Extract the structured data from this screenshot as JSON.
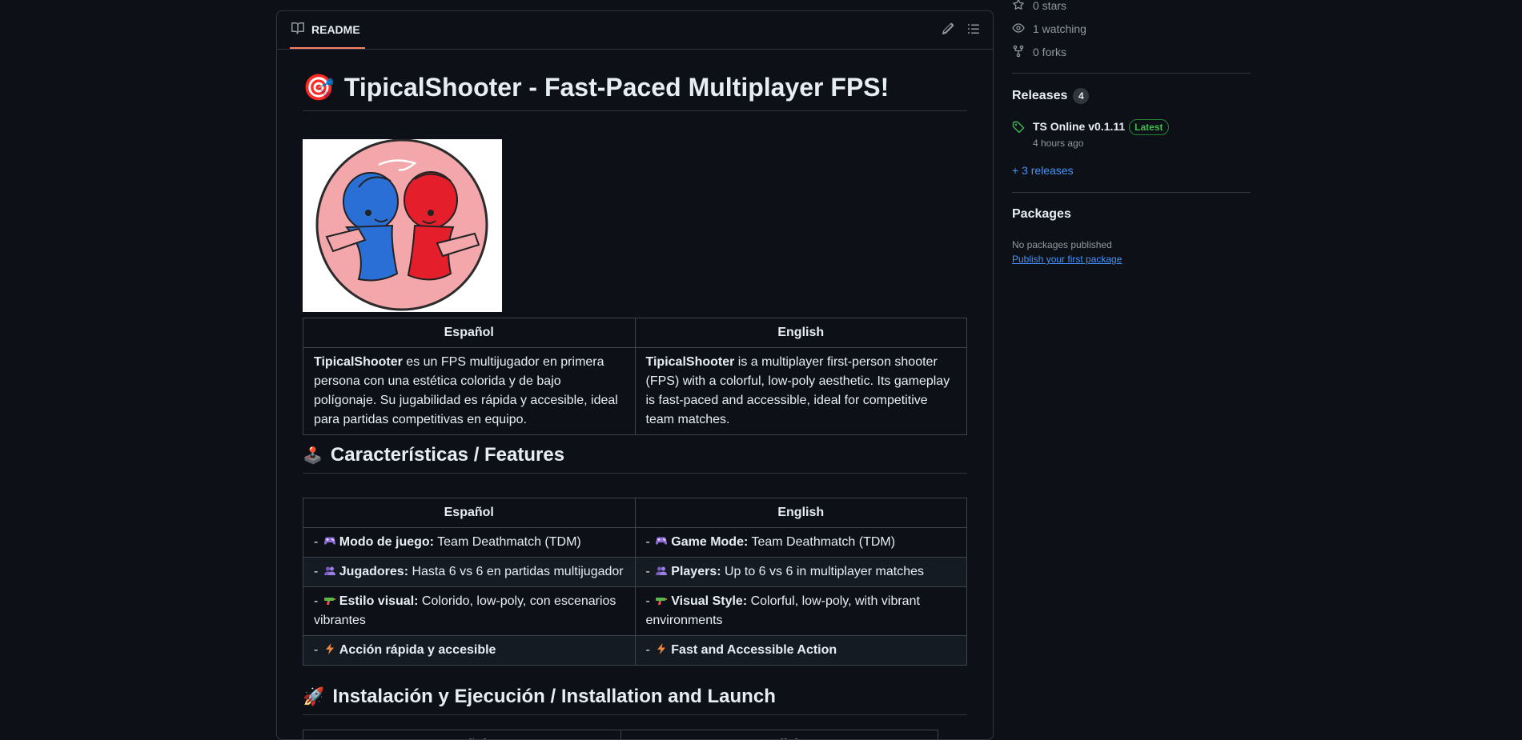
{
  "sidebar": {
    "stars": "0 stars",
    "watching": "1 watching",
    "forks": "0 forks",
    "releases_heading": "Releases",
    "releases_count": "4",
    "latest_release_name": "TS Online v0.1.11",
    "latest_badge": "Latest",
    "latest_release_time": "4 hours ago",
    "more_releases": "+ 3 releases",
    "packages_heading": "Packages",
    "packages_empty": "No packages published",
    "publish_link": "Publish your first package"
  },
  "readme": {
    "tab_label": "README",
    "title_emoji": "🎯",
    "title": "TipicalShooter - Fast-Paced Multiplayer FPS!",
    "intro": {
      "headers": [
        "Español",
        "English"
      ],
      "es_bold": "TipicalShooter",
      "es_text": " es un FPS multijugador en primera persona con una estética colorida y de bajo polígonaje. Su jugabilidad es rápida y accesible, ideal para partidas competitivas en equipo.",
      "en_bold": "TipicalShooter",
      "en_text": " is a multiplayer first-person shooter (FPS) with a colorful, low-poly aesthetic. Its gameplay is fast-paced and accessible, ideal for competitive team matches."
    },
    "features_emoji": "🕹️",
    "features_title": "Características / Features",
    "features": {
      "headers": [
        "Español",
        "English"
      ],
      "rows": [
        {
          "icon": "gamepad-icon",
          "es_bold": "Modo de juego:",
          "es_text": " Team Deathmatch (TDM)",
          "en_bold": "Game Mode:",
          "en_text": " Team Deathmatch (TDM)"
        },
        {
          "icon": "players-icon",
          "es_bold": "Jugadores:",
          "es_text": " Hasta 6 vs 6 en partidas multijugador",
          "en_bold": "Players:",
          "en_text": " Up to 6 vs 6 in multiplayer matches"
        },
        {
          "icon": "water-gun-icon",
          "es_bold": "Estilo visual:",
          "es_text": " Colorido, low-poly, con escenarios vibrantes",
          "en_bold": "Visual Style:",
          "en_text": " Colorful, low-poly, with vibrant environments"
        },
        {
          "icon": "lightning-icon",
          "es_bold": "Acción rápida y accesible",
          "es_text": "",
          "en_bold": "Fast and Accessible Action",
          "en_text": ""
        }
      ]
    },
    "install_emoji": "🚀",
    "install_title": "Instalación y Ejecución / Installation and Launch",
    "install_headers": [
      "Español",
      "English"
    ]
  }
}
